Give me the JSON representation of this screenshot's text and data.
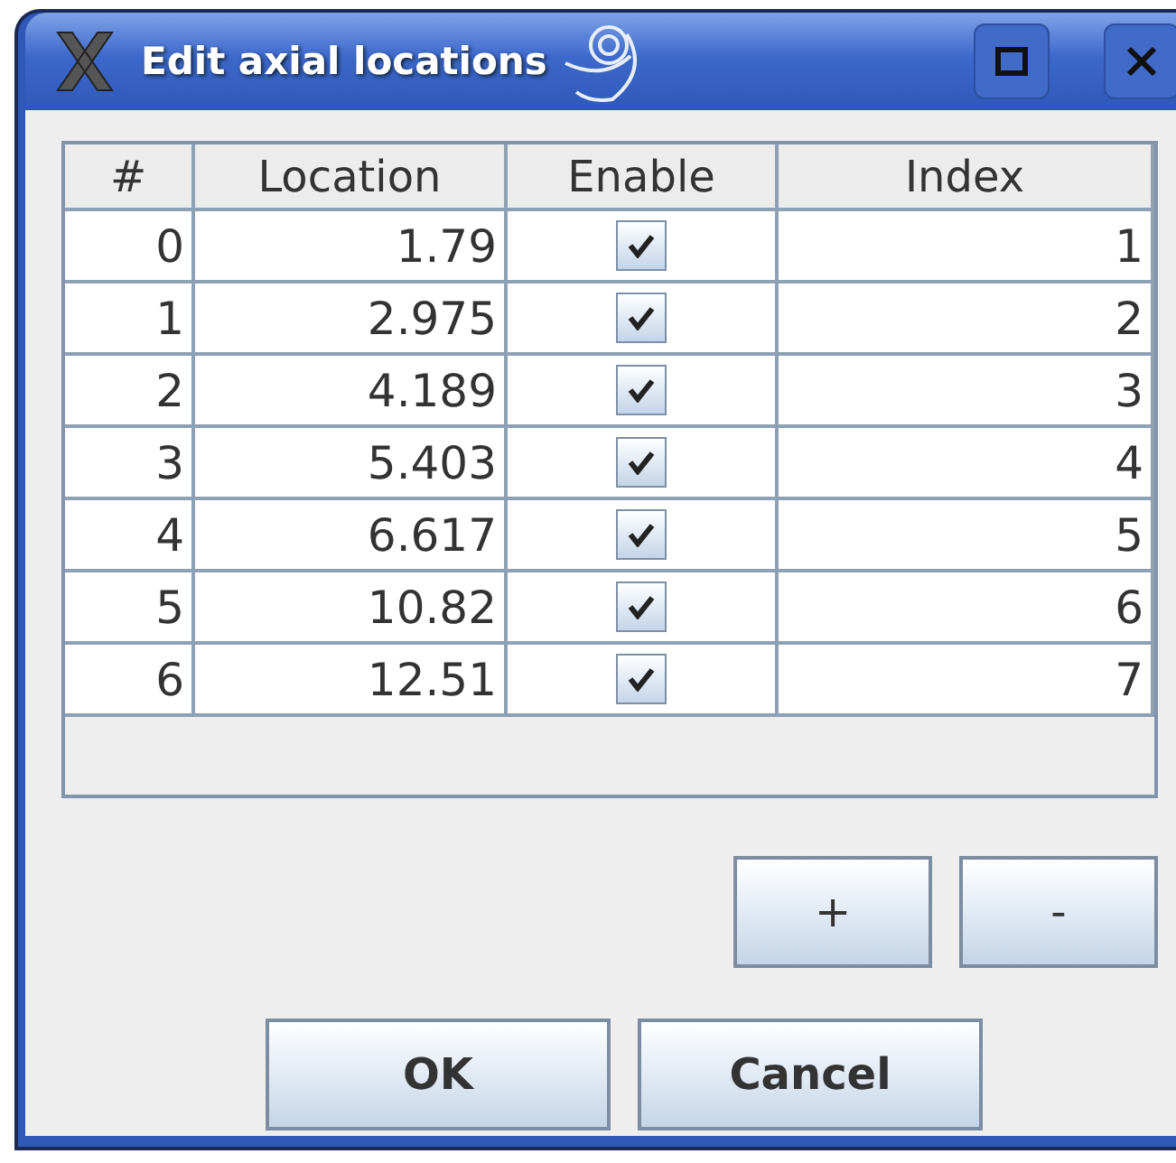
{
  "window": {
    "title": "Edit axial locations"
  },
  "table": {
    "columns": [
      "#",
      "Location",
      "Enable",
      "Index"
    ],
    "rows": [
      {
        "number": "0",
        "location": "1.79",
        "enabled": true,
        "index": "1"
      },
      {
        "number": "1",
        "location": "2.975",
        "enabled": true,
        "index": "2"
      },
      {
        "number": "2",
        "location": "4.189",
        "enabled": true,
        "index": "3"
      },
      {
        "number": "3",
        "location": "5.403",
        "enabled": true,
        "index": "4"
      },
      {
        "number": "4",
        "location": "6.617",
        "enabled": true,
        "index": "5"
      },
      {
        "number": "5",
        "location": "10.82",
        "enabled": true,
        "index": "6"
      },
      {
        "number": "6",
        "location": "12.51",
        "enabled": true,
        "index": "7"
      }
    ]
  },
  "row_buttons": [
    "+",
    "-"
  ],
  "buttons": [
    "OK",
    "Cancel"
  ]
}
